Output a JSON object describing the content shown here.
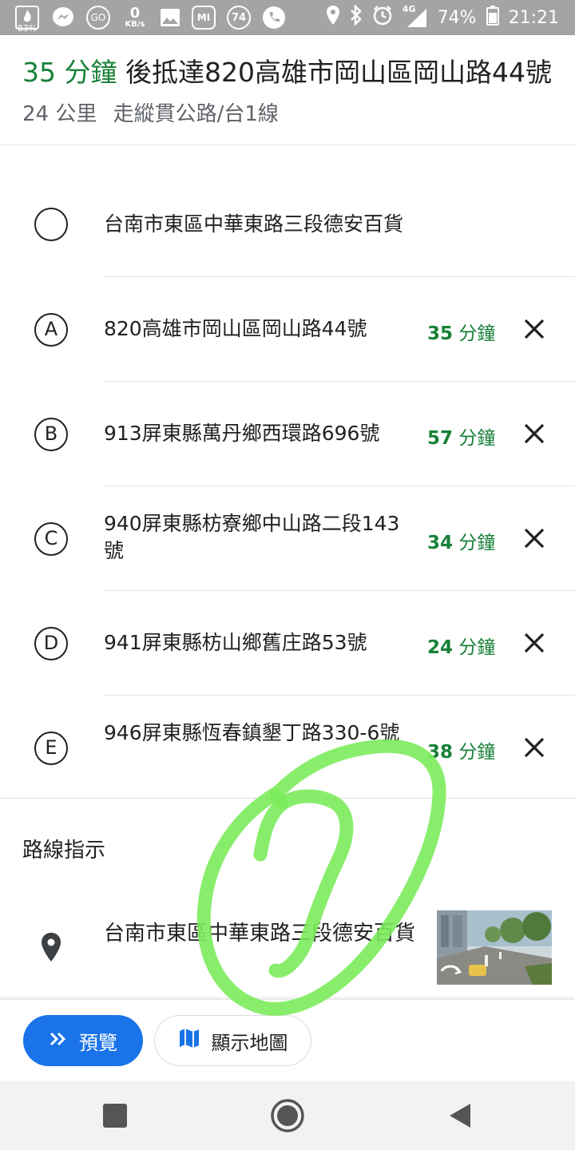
{
  "status_bar": {
    "left_icons": [
      "fire-icon",
      "messenger-icon",
      "go-icon",
      "data-speed-icon",
      "image-icon",
      "mi-icon",
      "weather-74-icon",
      "phone-icon"
    ],
    "fire_badge": "83%",
    "speed_value": "0",
    "speed_unit": "KB/s",
    "mi_label": "MI",
    "go_label": "GO",
    "badge_74": "74",
    "network": "4G",
    "battery": "74%",
    "time": "21:21"
  },
  "header": {
    "time": "35 分鐘",
    "destination": " 後抵達820高雄市岡山區岡山路44號",
    "distance": "24 公里",
    "route": "走縱貫公路/台1線"
  },
  "stops": [
    {
      "marker": "",
      "address": "台南市東區中華東路三段德安百貨",
      "time_num": "",
      "time_unit": "",
      "removable": false
    },
    {
      "marker": "A",
      "address": "820高雄市岡山區岡山路44號",
      "time_num": "35",
      "time_unit": " 分鐘",
      "removable": true
    },
    {
      "marker": "B",
      "address": "913屏東縣萬丹鄉西環路696號",
      "time_num": "57",
      "time_unit": " 分鐘",
      "removable": true
    },
    {
      "marker": "C",
      "address": "940屏東縣枋寮鄉中山路二段143號",
      "time_num": "34",
      "time_unit": " 分鐘",
      "removable": true
    },
    {
      "marker": "D",
      "address": "941屏東縣枋山鄉舊庄路53號",
      "time_num": "24",
      "time_unit": " 分鐘",
      "removable": true
    },
    {
      "marker": "E",
      "address": "946屏東縣恆春鎮墾丁路330-6號",
      "time_num": "38",
      "time_unit": " 分鐘",
      "removable": true
    }
  ],
  "directions": {
    "title": "路線指示",
    "first_step": "台南市東區中華東路三段德安百貨"
  },
  "bottom": {
    "preview_label": "預覽",
    "show_map_label": "顯示地圖"
  },
  "colors": {
    "accent_green": "#188038",
    "primary_blue": "#1a73e8",
    "annotation_green": "#7CEB5C",
    "status_bar_gray": "#a4a4a4"
  }
}
